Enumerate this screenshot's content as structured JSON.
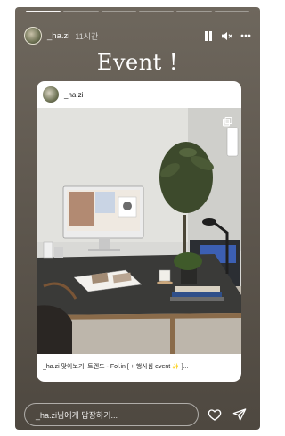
{
  "story": {
    "progress": {
      "segments_total": 6,
      "segments_done": 1
    },
    "user": {
      "name": "_ha.zi",
      "time": "11시간"
    },
    "title": "Event !",
    "card": {
      "username": "_ha.zi",
      "caption": "_ha.zi 맞아보기, 트렌드 - Fol.in [ + 행사심 event ✨ ]..."
    },
    "reply_placeholder": "_ha.zi님에게 답장하기..."
  },
  "icons": [
    "pause-icon",
    "mute-icon",
    "more-icon",
    "copy-icon",
    "heart-icon",
    "send-icon"
  ]
}
